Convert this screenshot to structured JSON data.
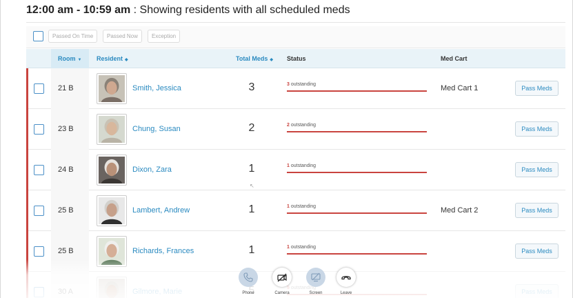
{
  "header": {
    "time_range": "12:00 am - 10:59 am",
    "description": " : Showing residents with all scheduled meds"
  },
  "toolbar": {
    "passed_on_time": "Passed On Time",
    "passed_now": "Passed Now",
    "exception": "Exception"
  },
  "table": {
    "columns": {
      "room": "Room",
      "resident": "Resident",
      "total_meds": "Total Meds",
      "status": "Status",
      "med_cart": "Med Cart"
    },
    "sort_icons": {
      "room": "▼",
      "resident": "◆",
      "total_meds": "◆"
    },
    "rows": [
      {
        "room": "21 B",
        "name": "Smith, Jessica",
        "meds": "3",
        "count": "3",
        "label": " outstanding",
        "cart": "Med Cart 1",
        "action": "Pass Meds"
      },
      {
        "room": "23 B",
        "name": "Chung, Susan",
        "meds": "2",
        "count": "2",
        "label": " outstanding",
        "cart": "",
        "action": "Pass Meds"
      },
      {
        "room": "24 B",
        "name": "Dixon, Zara",
        "meds": "1",
        "count": "1",
        "label": " outstanding",
        "cart": "",
        "action": "Pass Meds"
      },
      {
        "room": "25 B",
        "name": "Lambert, Andrew",
        "meds": "1",
        "count": "1",
        "label": " outstanding",
        "cart": "Med Cart 2",
        "action": "Pass Meds"
      },
      {
        "room": "25 B",
        "name": "Richards, Frances",
        "meds": "1",
        "count": "1",
        "label": " outstanding",
        "cart": "",
        "action": "Pass Meds"
      },
      {
        "room": "30 A",
        "name": "Gilmore, Marie",
        "meds": "5",
        "count": "5",
        "label": " outstanding",
        "cart": "",
        "action": "Pass Meds"
      }
    ]
  },
  "call_controls": {
    "phone": "Phone",
    "camera": "Camera",
    "screen": "Screen",
    "leave": "Leave"
  },
  "colors": {
    "accent_blue": "#2a8ac0",
    "status_red": "#c9433e",
    "header_bg": "#e9f3f8"
  },
  "icons": {
    "phone": "phone-icon",
    "camera": "camera-off-icon",
    "screen": "screen-share-icon",
    "leave": "hang-up-icon"
  }
}
